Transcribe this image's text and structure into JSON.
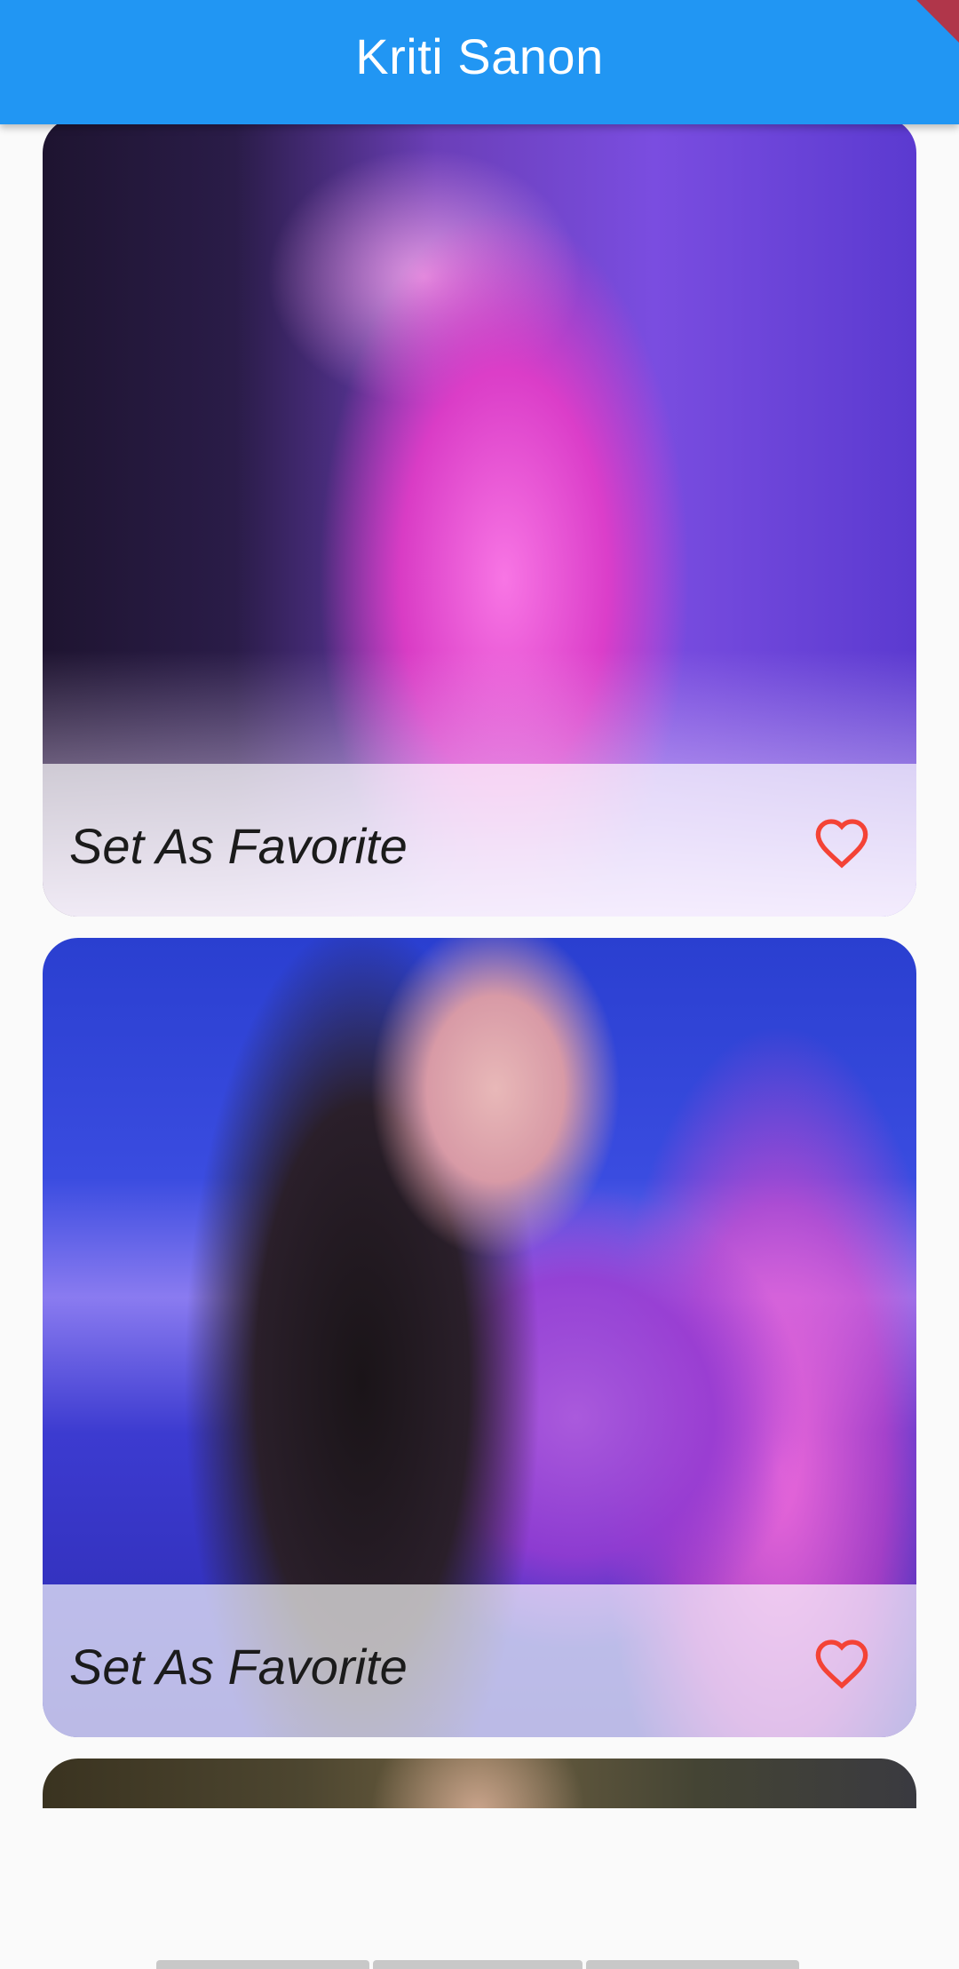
{
  "app_bar": {
    "title": "Kriti Sanon",
    "color": "#2196f3"
  },
  "cards": [
    {
      "favorite_label": "Set As Favorite",
      "icon": "heart-outline-icon"
    },
    {
      "favorite_label": "Set As Favorite",
      "icon": "heart-outline-icon"
    }
  ],
  "colors": {
    "heart": "#f44336",
    "background": "#fafafa"
  }
}
